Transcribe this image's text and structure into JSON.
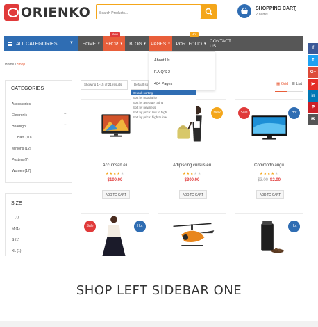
{
  "header": {
    "logo_text": "ORIENKO",
    "search_placeholder": "Search Products...",
    "cart_title": "SHOPPING CART",
    "cart_items": "2 items"
  },
  "nav": {
    "categories_label": "ALL CATEGORIES",
    "items": [
      {
        "label": "HOME"
      },
      {
        "label": "SHOP"
      },
      {
        "label": "BLOG"
      },
      {
        "label": "PAGES"
      },
      {
        "label": "PORTFOLIO"
      },
      {
        "label": "CONTACT US"
      }
    ],
    "shop_badge": "New",
    "portfolio_badge": "Hot"
  },
  "pages_menu": [
    "About Us",
    "F.A.Q'S 2",
    "404 Pages"
  ],
  "breadcrumb": {
    "home": "Home",
    "sep": " / ",
    "current": "Shop"
  },
  "sidebar": {
    "categories_title": "CATEGORIES",
    "categories": [
      {
        "label": "Accessories"
      },
      {
        "label": "Electronic"
      },
      {
        "label": "Headlight"
      },
      {
        "label": "Hats (10)"
      },
      {
        "label": "Minions (12)"
      },
      {
        "label": "Posters (7)"
      },
      {
        "label": "Women (17)"
      }
    ],
    "size_title": "SIZE",
    "sizes": [
      "L (1)",
      "M (1)",
      "S (1)",
      "XL (1)"
    ]
  },
  "toolbar": {
    "showing": "Showing 1–15 of 21 results",
    "sort_value": "Default sorting",
    "sort_options": [
      "Default sorting",
      "Sort by popularity",
      "Sort by average rating",
      "Sort by newness",
      "Sort by price: low to high",
      "Sort by price: high to low"
    ],
    "grid_label": "Grid",
    "list_label": "List"
  },
  "products": [
    {
      "name": "Accumsan eli",
      "rating": 4,
      "price": "$100.00",
      "old_price": "",
      "tag": "",
      "add": "ADD TO CART"
    },
    {
      "name": "Adipiscing cursus eu",
      "rating": 3,
      "price": "$300.00",
      "old_price": "",
      "tag": "New",
      "add": "ADD TO CART"
    },
    {
      "name": "Commodo augu",
      "rating": 4,
      "price": "$2.00",
      "old_price": "$3.00",
      "tag": "Sale",
      "tag2": "Hot",
      "add": "ADD TO CART"
    },
    {
      "name": "",
      "tag": "Sale",
      "tag2": "Hot"
    },
    {
      "name": ""
    },
    {
      "name": "",
      "tag": "Hot"
    }
  ],
  "social": [
    "f",
    "t",
    "G+",
    "▶",
    "in",
    "P",
    "✉"
  ],
  "page_title": "SHOP LEFT SIDEBAR ONE",
  "colors": {
    "accent": "#e85e3a",
    "blue": "#2f6db3",
    "orange": "#f4a61a",
    "red": "#e03a3a",
    "dark": "#575757"
  }
}
